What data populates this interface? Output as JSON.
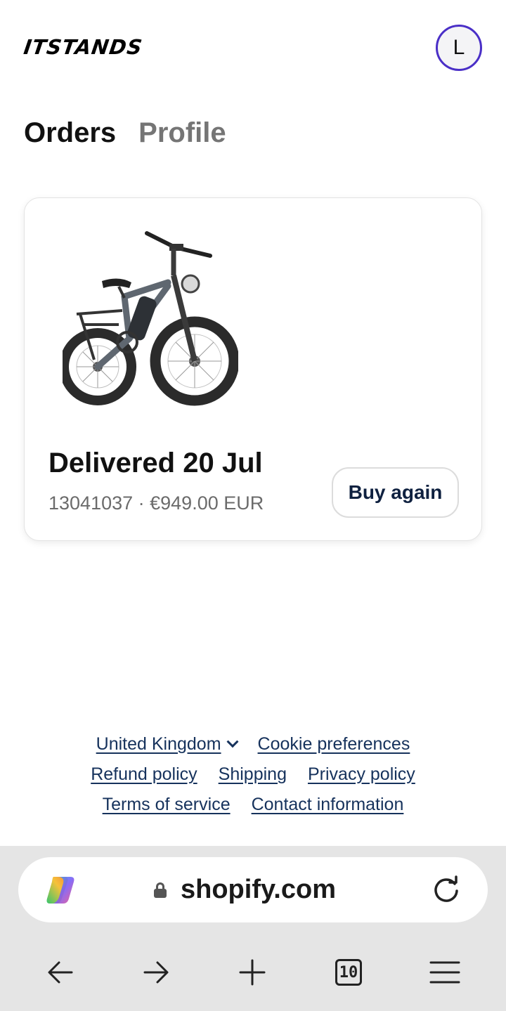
{
  "header": {
    "logo_text": "ITSTANDS",
    "avatar_initial": "L"
  },
  "tabs": [
    {
      "label": "Orders",
      "active": true
    },
    {
      "label": "Profile",
      "active": false
    }
  ],
  "order": {
    "product_image": "electric-fat-tire-bike",
    "status": "Delivered 20 Jul",
    "meta": "13041037 · €949.00 EUR",
    "buy_again_label": "Buy again"
  },
  "footer": {
    "country": "United Kingdom",
    "cookie": "Cookie preferences",
    "refund": "Refund policy",
    "shipping": "Shipping",
    "privacy": "Privacy policy",
    "terms": "Terms of service",
    "contact": "Contact information"
  },
  "browser": {
    "url": "shopify.com",
    "tab_count": "10",
    "icons": [
      "copilot-icon",
      "lock-icon",
      "reload-icon",
      "back-icon",
      "forward-icon",
      "new-tab-icon",
      "tabs-icon",
      "menu-icon"
    ]
  },
  "colors": {
    "avatar_ring": "#4a2fc7",
    "link": "#16325c",
    "button_text": "#0f2140",
    "muted": "#6b6b6b",
    "chrome_bg": "#e5e5e5"
  }
}
